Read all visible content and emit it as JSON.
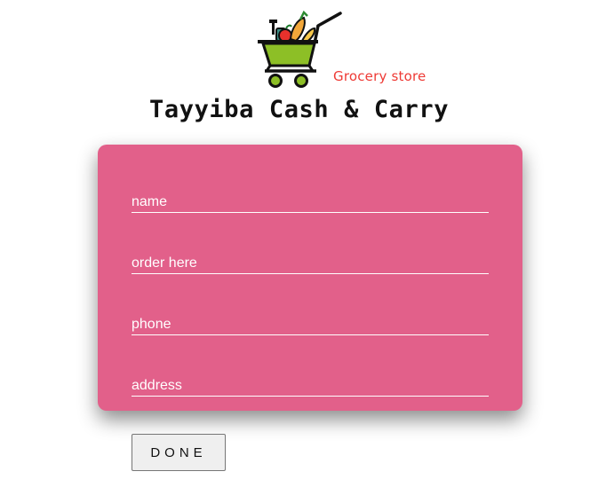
{
  "logo": {
    "icon": "shopping-cart-with-groceries",
    "tagline": "Grocery store",
    "name": "Tayyiba Cash & Carry",
    "tagline_color": "#ee3a35",
    "cart_color": "#8dbf26"
  },
  "form": {
    "background_color": "#e2608a",
    "name_placeholder": "name",
    "order_placeholder": "order here",
    "phone_placeholder": "phone",
    "address_placeholder": "address"
  },
  "actions": {
    "done_label": "DONE"
  }
}
